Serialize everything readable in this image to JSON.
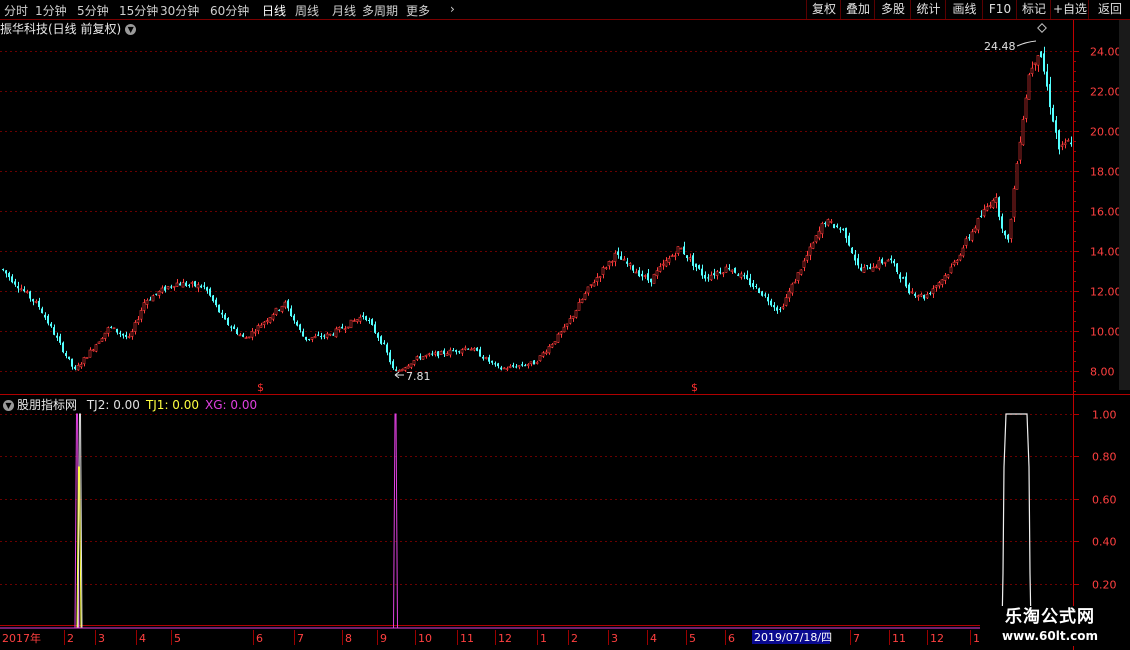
{
  "toolbar": {
    "periods": [
      {
        "label": "分时",
        "active": false
      },
      {
        "label": "1分钟",
        "active": false
      },
      {
        "label": "5分钟",
        "active": false
      },
      {
        "label": "15分钟",
        "active": false
      },
      {
        "label": "30分钟",
        "active": false
      },
      {
        "label": "60分钟",
        "active": false
      },
      {
        "label": "日线",
        "active": true
      },
      {
        "label": "周线",
        "active": false
      },
      {
        "label": "月线",
        "active": false
      },
      {
        "label": "多周期",
        "active": false
      },
      {
        "label": "更多",
        "active": false
      }
    ],
    "tools": [
      "复权",
      "叠加",
      "多股",
      "统计",
      "画线",
      "F10",
      "标记",
      "+自选",
      "返回"
    ]
  },
  "chart": {
    "title": "振华科技(日线 前复权)",
    "max_label": "24.48",
    "min_label": "7.81",
    "marker_glyph": "$",
    "y_axis_ticks": [
      "24.00",
      "22.00",
      "20.00",
      "18.00",
      "16.00",
      "14.00",
      "12.00",
      "10.00",
      "8.00"
    ],
    "colors": {
      "up": "#ff3c3c",
      "down": "#54ffff",
      "grid": "#6a0000",
      "axis": "#b00000",
      "tick_text": "#ff4040"
    }
  },
  "indicator": {
    "name": "股朋指标网",
    "values": [
      {
        "label": "TJ2: 0.00",
        "color": "#e0e0e0"
      },
      {
        "label": "TJ1: 0.00",
        "color": "#ffff40"
      },
      {
        "label": "XG: 0.00",
        "color": "#e040e0"
      }
    ],
    "y_axis_ticks": [
      "1.00",
      "0.80",
      "0.60",
      "0.40",
      "0.20"
    ]
  },
  "time_axis": {
    "labels": [
      "2017年",
      "2",
      "3",
      "4",
      "5",
      "6",
      "7",
      "8",
      "9",
      "10",
      "11",
      "12",
      "1",
      "2",
      "3",
      "4",
      "5",
      "6",
      "7",
      "10",
      "11",
      "12",
      "1"
    ],
    "cursor_date": "2019/07/18/四"
  },
  "watermark": {
    "title": "乐淘公式网",
    "url": "www.60lt.com"
  },
  "chart_data": {
    "type": "candlestick",
    "title": "振华科技(日线 前复权)",
    "y_range": [
      7.5,
      25.0
    ],
    "max_price": 24.48,
    "min_price": 7.81,
    "price_path": [
      [
        0,
        13.2
      ],
      [
        40,
        11.2
      ],
      [
        75,
        8.0
      ],
      [
        110,
        10.2
      ],
      [
        130,
        9.6
      ],
      [
        145,
        11.5
      ],
      [
        175,
        12.4
      ],
      [
        205,
        12.2
      ],
      [
        225,
        10.5
      ],
      [
        245,
        9.6
      ],
      [
        285,
        11.4
      ],
      [
        305,
        9.6
      ],
      [
        330,
        9.8
      ],
      [
        365,
        10.8
      ],
      [
        385,
        9.2
      ],
      [
        395,
        7.9
      ],
      [
        420,
        8.7
      ],
      [
        445,
        8.9
      ],
      [
        470,
        9.2
      ],
      [
        500,
        8.1
      ],
      [
        535,
        8.4
      ],
      [
        565,
        10.1
      ],
      [
        590,
        12.2
      ],
      [
        615,
        13.8
      ],
      [
        650,
        12.5
      ],
      [
        680,
        14.2
      ],
      [
        705,
        12.7
      ],
      [
        730,
        13.2
      ],
      [
        760,
        12.0
      ],
      [
        780,
        11.0
      ],
      [
        800,
        13.0
      ],
      [
        825,
        15.5
      ],
      [
        845,
        15.0
      ],
      [
        860,
        13.0
      ],
      [
        890,
        13.6
      ],
      [
        910,
        12.0
      ],
      [
        925,
        11.7
      ],
      [
        950,
        13.0
      ],
      [
        975,
        15.2
      ],
      [
        995,
        16.8
      ],
      [
        1008,
        14.2
      ],
      [
        1020,
        19.5
      ],
      [
        1030,
        23.0
      ],
      [
        1040,
        24.2
      ],
      [
        1050,
        21.5
      ],
      [
        1060,
        19.0
      ],
      [
        1070,
        19.5
      ]
    ],
    "indicator_series": [
      {
        "name": "TJ2",
        "spike_dates_approx": [
          "2017年2月",
          "2017年10月"
        ],
        "max": 1.0
      },
      {
        "name": "TJ1",
        "spike_dates_approx": [
          "2017年2月"
        ],
        "max": 0.75
      },
      {
        "name": "XG",
        "spike_dates_approx": [
          "2017年2月",
          "2017年10月"
        ],
        "max": 1.0
      },
      {
        "name": "plateau",
        "range_approx": [
          "2019年1月",
          "2019年1月"
        ],
        "max": 1.0,
        "mid": 0.75
      }
    ]
  }
}
